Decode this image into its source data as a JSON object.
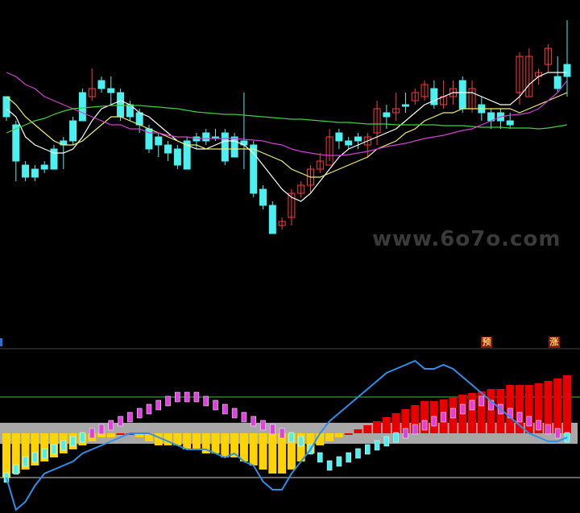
{
  "watermark": "www.6o7o.com",
  "badges": {
    "predict": "预",
    "rise": "涨"
  },
  "colors": {
    "background": "#000000",
    "up": "#ff3b3b",
    "down": "#4df0f0",
    "ma_short": "#ffffff",
    "ma_mid": "#f0f070",
    "ma_long": "#d040d0",
    "ma_slow": "#40d040",
    "osc_line": "#2f8fe8",
    "osc_band": "#a8a8a8",
    "osc_neg": "#ffd400",
    "osc_pos": "#e80000",
    "osc_mark": "#e040e0"
  },
  "chart_data": [
    {
      "type": "candlestick",
      "title": "",
      "candles": [
        [
          120,
          145,
          120,
          150
        ],
        [
          155,
          200,
          150,
          225
        ],
        [
          205,
          220,
          200,
          225
        ],
        [
          210,
          220,
          205,
          225
        ],
        [
          205,
          210,
          200,
          215
        ],
        [
          185,
          210,
          180,
          210
        ],
        [
          175,
          180,
          170,
          210
        ],
        [
          150,
          175,
          145,
          180
        ],
        [
          115,
          150,
          110,
          150
        ],
        [
          120,
          110,
          85,
          125
        ],
        [
          100,
          110,
          95,
          115
        ],
        [
          110,
          115,
          95,
          130
        ],
        [
          115,
          145,
          110,
          150
        ],
        [
          130,
          145,
          125,
          150
        ],
        [
          140,
          155,
          135,
          165
        ],
        [
          160,
          185,
          155,
          190
        ],
        [
          170,
          180,
          165,
          195
        ],
        [
          180,
          190,
          175,
          200
        ],
        [
          185,
          205,
          180,
          210
        ],
        [
          175,
          210,
          170,
          210
        ],
        [
          170,
          175,
          165,
          185
        ],
        [
          165,
          175,
          160,
          180
        ],
        [
          170,
          170,
          160,
          175
        ],
        [
          165,
          200,
          160,
          205
        ],
        [
          170,
          195,
          165,
          195
        ],
        [
          175,
          180,
          115,
          210
        ],
        [
          180,
          240,
          175,
          245
        ],
        [
          235,
          255,
          230,
          260
        ],
        [
          255,
          290,
          250,
          290
        ],
        [
          280,
          275,
          270,
          285
        ],
        [
          270,
          240,
          235,
          280
        ],
        [
          240,
          230,
          225,
          245
        ],
        [
          230,
          210,
          205,
          240
        ],
        [
          210,
          200,
          190,
          215
        ],
        [
          205,
          170,
          160,
          200
        ],
        [
          165,
          175,
          160,
          185
        ],
        [
          175,
          180,
          170,
          185
        ],
        [
          170,
          175,
          165,
          185
        ],
        [
          180,
          170,
          165,
          195
        ],
        [
          165,
          135,
          125,
          180
        ],
        [
          140,
          145,
          130,
          160
        ],
        [
          140,
          135,
          115,
          150
        ],
        [
          130,
          130,
          115,
          140
        ],
        [
          125,
          115,
          110,
          130
        ],
        [
          120,
          105,
          100,
          125
        ],
        [
          110,
          130,
          100,
          135
        ],
        [
          130,
          120,
          100,
          135
        ],
        [
          120,
          110,
          100,
          130
        ],
        [
          100,
          135,
          95,
          140
        ],
        [
          135,
          110,
          100,
          140
        ],
        [
          130,
          140,
          120,
          150
        ],
        [
          140,
          150,
          135,
          160
        ],
        [
          140,
          150,
          135,
          160
        ],
        [
          150,
          155,
          140,
          160
        ],
        [
          115,
          70,
          65,
          130
        ],
        [
          120,
          70,
          60,
          120
        ],
        [
          95,
          90,
          85,
          105
        ],
        [
          80,
          60,
          55,
          90
        ],
        [
          95,
          110,
          70,
          115
        ],
        [
          80,
          95,
          25,
          120
        ]
      ],
      "moving_averages": [
        {
          "values": [
            135,
            145,
            170,
            180,
            185,
            190,
            190,
            185,
            170,
            150,
            135,
            130,
            125,
            130,
            140,
            145,
            155,
            165,
            175,
            180,
            185,
            185,
            180,
            175,
            175,
            180,
            190,
            205,
            220,
            235,
            245,
            250,
            240,
            225,
            210,
            195,
            185,
            180,
            175,
            170,
            165,
            160,
            150,
            140,
            130,
            125,
            120,
            115,
            115,
            115,
            120,
            125,
            130,
            130,
            120,
            105,
            95,
            90,
            90,
            90
          ]
        },
        {
          "values": [
            120,
            130,
            145,
            155,
            165,
            175,
            180,
            180,
            175,
            165,
            155,
            145,
            145,
            150,
            155,
            160,
            165,
            170,
            175,
            180,
            180,
            185,
            185,
            185,
            185,
            185,
            185,
            190,
            195,
            200,
            210,
            215,
            220,
            220,
            215,
            210,
            205,
            200,
            195,
            185,
            180,
            175,
            165,
            160,
            150,
            145,
            140,
            140,
            135,
            135,
            135,
            135,
            135,
            135,
            140,
            135,
            130,
            125,
            120,
            115
          ]
        },
        {
          "values": [
            90,
            95,
            105,
            110,
            120,
            125,
            130,
            135,
            140,
            145,
            150,
            155,
            155,
            160,
            160,
            165,
            165,
            168,
            170,
            170,
            172,
            172,
            172,
            172,
            172,
            173,
            174,
            175,
            178,
            180,
            185,
            188,
            190,
            192,
            193,
            193,
            192,
            190,
            188,
            185,
            182,
            180,
            178,
            175,
            172,
            170,
            168,
            165,
            162,
            160,
            155,
            150,
            145,
            143,
            142,
            140,
            135,
            125,
            115,
            100
          ]
        },
        {
          "values": [
            165,
            160,
            155,
            150,
            147,
            142,
            138,
            135,
            134,
            133,
            132,
            131,
            131,
            131,
            131,
            132,
            133,
            134,
            135,
            137,
            139,
            140,
            141,
            142,
            142,
            143,
            144,
            145,
            146,
            147,
            148,
            148,
            149,
            150,
            151,
            152,
            152,
            153,
            154,
            154,
            154,
            155,
            155,
            155,
            155,
            155,
            156,
            156,
            156,
            157,
            158,
            158,
            158,
            159,
            159,
            159,
            160,
            159,
            157,
            155
          ]
        }
      ]
    },
    {
      "type": "histogram",
      "title": "",
      "band_level": [
        -15,
        -15
      ],
      "reference_lines": [
        45,
        -55
      ],
      "line": [
        -55,
        -95,
        -85,
        -65,
        -50,
        -45,
        -40,
        -35,
        -25,
        -20,
        -15,
        -10,
        -5,
        0,
        0,
        0,
        -5,
        -10,
        -15,
        -20,
        -20,
        -20,
        -25,
        -30,
        -25,
        -35,
        -40,
        -60,
        -70,
        -70,
        -50,
        -35,
        -20,
        0,
        15,
        25,
        35,
        45,
        55,
        65,
        75,
        80,
        85,
        90,
        80,
        80,
        85,
        80,
        70,
        60,
        50,
        40,
        30,
        20,
        10,
        0,
        -5,
        -10,
        -10,
        -5
      ],
      "histogram": [
        -55,
        -50,
        -45,
        -40,
        -35,
        -30,
        -25,
        -20,
        -15,
        -10,
        -5,
        -5,
        0,
        0,
        -5,
        -10,
        -15,
        -15,
        -15,
        -20,
        -20,
        -25,
        -25,
        -30,
        -30,
        -35,
        -40,
        -45,
        -50,
        -50,
        -45,
        -35,
        -25,
        -15,
        -10,
        -5,
        0,
        5,
        10,
        15,
        20,
        25,
        30,
        35,
        40,
        40,
        42,
        45,
        48,
        50,
        52,
        55,
        55,
        60,
        60,
        60,
        62,
        65,
        68,
        72
      ],
      "marker_bars": [
        -55,
        -45,
        -35,
        -30,
        -25,
        -20,
        -15,
        -10,
        -5,
        0,
        5,
        10,
        15,
        20,
        25,
        30,
        35,
        40,
        45,
        45,
        45,
        40,
        35,
        30,
        25,
        20,
        15,
        10,
        5,
        0,
        -5,
        -10,
        -20,
        -30,
        -40,
        -35,
        -30,
        -25,
        -20,
        -15,
        -10,
        -5,
        0,
        5,
        10,
        15,
        20,
        25,
        30,
        35,
        40,
        35,
        30,
        25,
        20,
        15,
        10,
        5,
        0,
        -5
      ],
      "rise_badge_index": 57,
      "predict_badge_index": 50
    }
  ]
}
